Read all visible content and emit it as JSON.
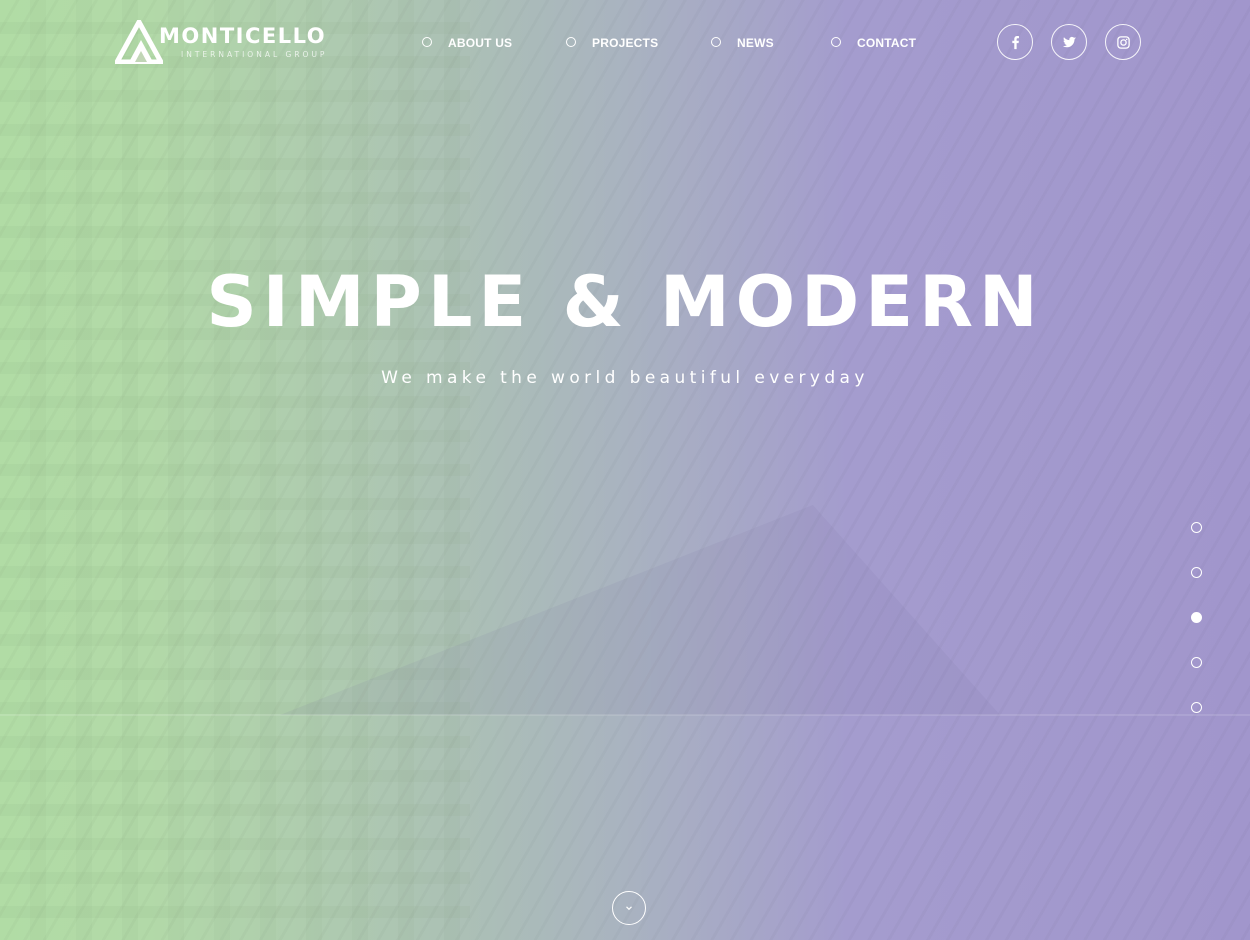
{
  "brand": {
    "name": "MONTICELLO",
    "tagline": "INTERNATIONAL GROUP",
    "logo_icon": "triangle-logo-icon"
  },
  "nav": {
    "items": [
      {
        "label": "ABOUT US",
        "icon": "circle-bullet-icon"
      },
      {
        "label": "PROJECTS",
        "icon": "circle-bullet-icon"
      },
      {
        "label": "NEWS",
        "icon": "circle-bullet-icon"
      },
      {
        "label": "CONTACT",
        "icon": "circle-bullet-icon"
      }
    ]
  },
  "social": [
    {
      "name": "facebook",
      "icon": "facebook-icon"
    },
    {
      "name": "twitter",
      "icon": "twitter-icon"
    },
    {
      "name": "instagram",
      "icon": "instagram-icon"
    }
  ],
  "hero": {
    "title": "SIMPLE & MODERN",
    "subtitle": "We make the world beautiful everyday"
  },
  "slider": {
    "count": 5,
    "active_index": 2
  },
  "scroll": {
    "icon": "chevron-down-icon"
  },
  "colors": {
    "gradient_left": "#b1dca5",
    "gradient_right": "#a196cc",
    "text": "#ffffff"
  }
}
